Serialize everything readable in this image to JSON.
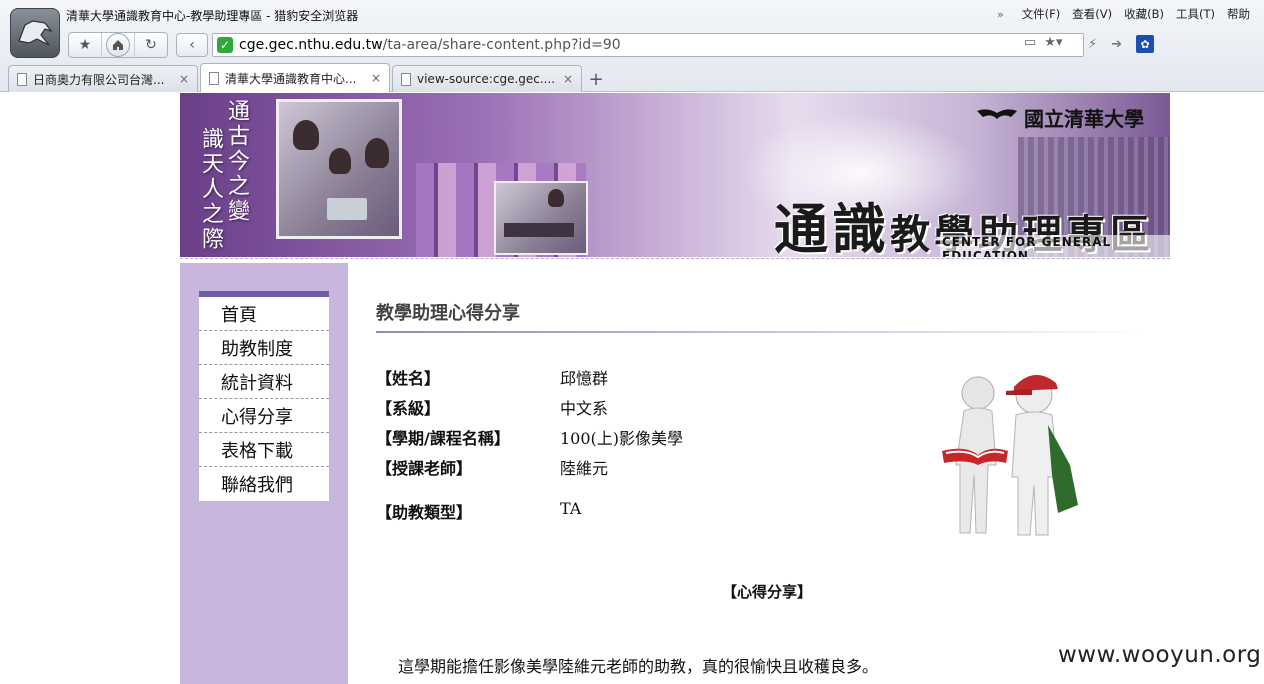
{
  "browser": {
    "window_title": "清華大學通識教育中心-教學助理專區 - 猎豹安全浏览器",
    "menu": [
      "文件(F)",
      "查看(V)",
      "收藏(B)",
      "工具(T)",
      "帮助"
    ],
    "url_host": "cge.gec.nthu.edu.tw",
    "url_path": "/ta-area/share-content.php?id=90",
    "tabs": [
      {
        "label": "日商奧力有限公司台灣...",
        "active": false
      },
      {
        "label": "清華大學通識教育中心...",
        "active": true
      },
      {
        "label": "view-source:cge.gec....",
        "active": false
      }
    ],
    "new_tab": "+"
  },
  "banner": {
    "motto_col1": "通古今之變",
    "motto_col2": "識天人之際",
    "university": "國立清華大學",
    "section_title_big": "通識",
    "section_title_rest": "教學助理專區",
    "section_en": "CENTER FOR GENERAL EDUCATION",
    "accent_color": "#6d5ea6"
  },
  "nav": {
    "items": [
      "首頁",
      "助教制度",
      "統計資料",
      "心得分享",
      "表格下載",
      "聯絡我們"
    ]
  },
  "content": {
    "heading": "教學助理心得分享",
    "fields": [
      {
        "label": "【姓名】",
        "value": "邱憶群"
      },
      {
        "label": "【系級】",
        "value": "中文系"
      },
      {
        "label": "【學期/課程名稱】",
        "value": "100(上)影像美學"
      },
      {
        "label": "【授課老師】",
        "value": "陸維元"
      },
      {
        "label": "【助教類型】",
        "value": "TA"
      }
    ],
    "share_heading": "【心得分享】",
    "paragraph": "這學期能擔任影像美學陸維元老師的助教，真的很愉快且收穫良多。"
  },
  "watermark": "www.wooyun.org"
}
